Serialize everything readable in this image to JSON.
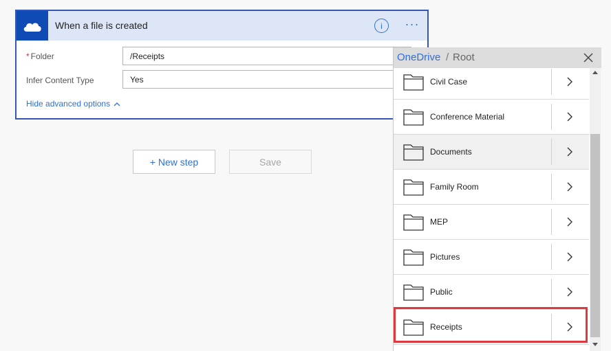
{
  "trigger": {
    "title": "When a file is created",
    "info_icon": "info-icon",
    "more_label": "···",
    "fields": [
      {
        "label": "Folder",
        "required": "*",
        "value": "/Receipts"
      },
      {
        "label": "Infer Content Type",
        "value": "Yes"
      }
    ],
    "hide_advanced": "Hide advanced options"
  },
  "actions": {
    "new_step": "+ New step",
    "save": "Save"
  },
  "picker": {
    "root_link": "OneDrive",
    "separator": "/",
    "current": "Root",
    "close_icon": "close-icon",
    "folders": [
      {
        "name": "Civil Case"
      },
      {
        "name": "Conference Material"
      },
      {
        "name": "Documents"
      },
      {
        "name": "Family Room"
      },
      {
        "name": "MEP"
      },
      {
        "name": "Pictures"
      },
      {
        "name": "Public"
      },
      {
        "name": "Receipts"
      }
    ]
  },
  "colors": {
    "accent": "#2f6fd6",
    "header_bg": "#dde6f6",
    "logo_bg": "#0f4bb4",
    "highlight": "#e0383e"
  }
}
